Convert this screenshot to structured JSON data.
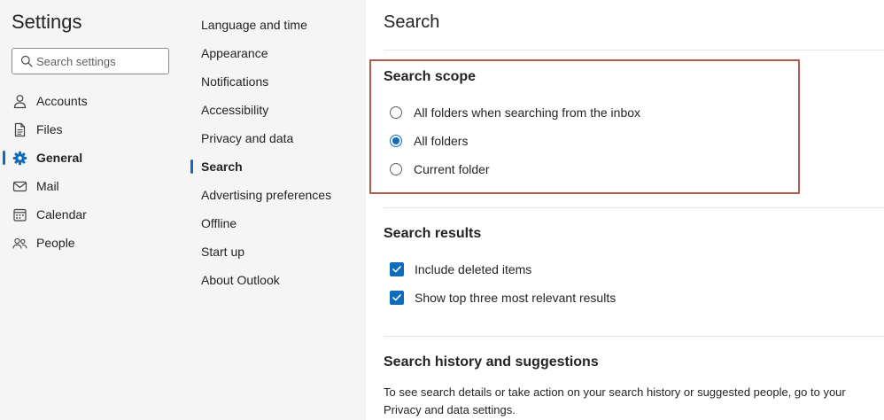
{
  "app": {
    "title": "Settings",
    "search": {
      "placeholder": "Search settings",
      "value": ""
    }
  },
  "categories": [
    {
      "label": "Accounts",
      "icon": "person-icon",
      "active": false
    },
    {
      "label": "Files",
      "icon": "document-icon",
      "active": false
    },
    {
      "label": "General",
      "icon": "gear-icon",
      "active": true
    },
    {
      "label": "Mail",
      "icon": "mail-icon",
      "active": false
    },
    {
      "label": "Calendar",
      "icon": "calendar-icon",
      "active": false
    },
    {
      "label": "People",
      "icon": "people-icon",
      "active": false
    }
  ],
  "subnav": [
    {
      "label": "Language and time",
      "active": false
    },
    {
      "label": "Appearance",
      "active": false
    },
    {
      "label": "Notifications",
      "active": false
    },
    {
      "label": "Accessibility",
      "active": false
    },
    {
      "label": "Privacy and data",
      "active": false
    },
    {
      "label": "Search",
      "active": true
    },
    {
      "label": "Advertising preferences",
      "active": false
    },
    {
      "label": "Offline",
      "active": false
    },
    {
      "label": "Start up",
      "active": false
    },
    {
      "label": "About Outlook",
      "active": false
    }
  ],
  "page": {
    "title": "Search",
    "scope": {
      "title": "Search scope",
      "options": [
        {
          "label": "All folders when searching from the inbox",
          "checked": false
        },
        {
          "label": "All folders",
          "checked": true
        },
        {
          "label": "Current folder",
          "checked": false
        }
      ]
    },
    "results": {
      "title": "Search results",
      "options": [
        {
          "label": "Include deleted items",
          "checked": true
        },
        {
          "label": "Show top three most relevant results",
          "checked": true
        }
      ]
    },
    "history": {
      "title": "Search history and suggestions",
      "description": "To see search details or take action on your search history or suggested people, go to your Privacy and data settings."
    }
  },
  "colors": {
    "accent": "#0f6cbd",
    "highlight_border": "#b05c4e",
    "pane_bg": "#f5f5f5"
  }
}
